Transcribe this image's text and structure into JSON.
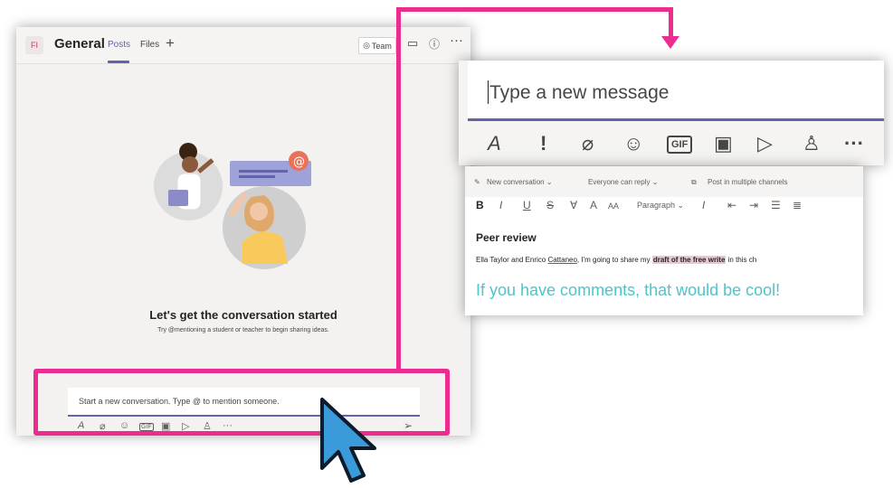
{
  "teams_window": {
    "avatar_initials": "FI",
    "channel_name": "General",
    "tabs": [
      {
        "label": "Posts",
        "active": true
      },
      {
        "label": "Files",
        "active": false
      }
    ],
    "add_tab_label": "+",
    "team_button_label": "Team",
    "more_label": "···",
    "empty_state": {
      "title": "Let's get the conversation started",
      "subtitle": "Try @mentioning a student or teacher to begin sharing ideas."
    },
    "compose": {
      "placeholder": "Start a new conversation. Type @ to mention someone.",
      "tools": [
        "format-icon",
        "attach-icon",
        "emoji-icon",
        "gif-icon",
        "sticker-icon",
        "stream-icon",
        "praise-icon",
        "more-icon"
      ],
      "more_label": "···"
    }
  },
  "zoom_compose": {
    "placeholder": "Type a new message",
    "tools": [
      {
        "icon": "format-icon",
        "glyph": "A"
      },
      {
        "icon": "important-icon",
        "glyph": "!"
      },
      {
        "icon": "attach-icon",
        "glyph": "𝒪"
      },
      {
        "icon": "emoji-icon",
        "glyph": "☺"
      },
      {
        "icon": "gif-icon",
        "glyph": "GIF"
      },
      {
        "icon": "sticker-icon",
        "glyph": "▣"
      },
      {
        "icon": "send-icon",
        "glyph": "▷"
      },
      {
        "icon": "praise-icon",
        "glyph": "♙"
      },
      {
        "icon": "more-icon",
        "glyph": "···"
      }
    ]
  },
  "format_panel": {
    "new_conversation": "New conversation",
    "everyone_can_reply": "Everyone can reply",
    "post_multiple": "Post in multiple channels",
    "paragraph": "Paragraph",
    "bold": "B",
    "italic": "I",
    "underline": "U",
    "strike": "S",
    "title": "Peer review",
    "line_pre": "Ella Taylor and Enrico ",
    "line_mention": "Cattaneo",
    "line_mid": ", I'm going to share my ",
    "line_highlight": "draft of the free write",
    "line_post": " in this ch",
    "quote": "If you have comments, that would be cool!"
  },
  "colors": {
    "accent": "#6264a7",
    "callout": "#ec2d8f",
    "quote": "#4fc4c9",
    "cursor": "#3b9ad9"
  }
}
